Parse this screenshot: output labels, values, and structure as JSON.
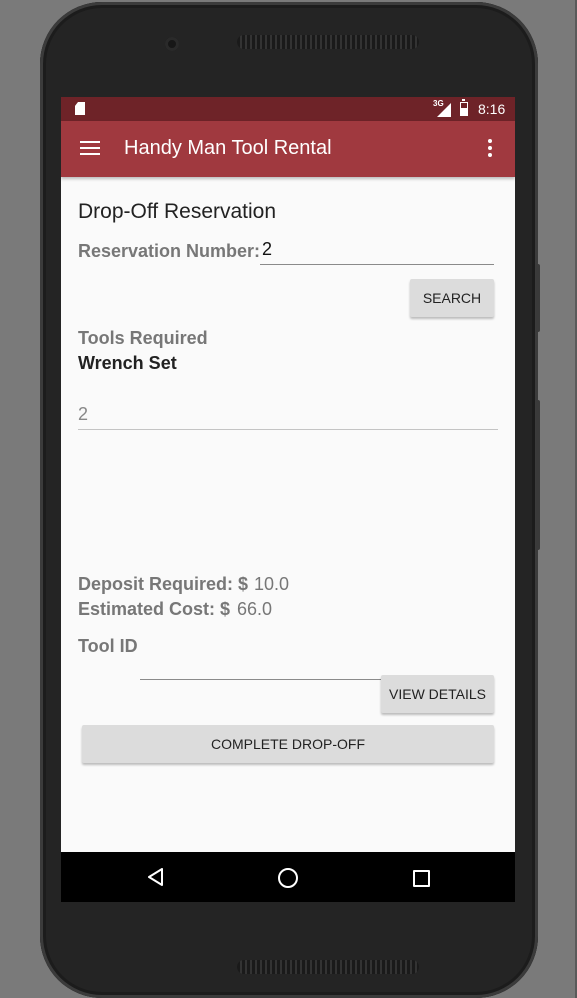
{
  "status_bar": {
    "network": "3G",
    "time": "8:16"
  },
  "app_bar": {
    "title": "Handy Man Tool Rental",
    "menu_icon": "hamburger-menu-icon",
    "overflow_icon": "more-vertical-icon"
  },
  "form": {
    "page_title": "Drop-Off Reservation",
    "reservation_number_label": "Reservation Number:",
    "reservation_number_value": "2",
    "search_button": "SEARCH",
    "tools_required_label": "Tools Required",
    "tool_name": "Wrench Set",
    "quantity_value": "2",
    "deposit_label": "Deposit Required: $",
    "deposit_value": "10.0",
    "estimated_cost_label": "Estimated Cost: $",
    "estimated_cost_value": "66.0",
    "tool_id_label": "Tool ID",
    "tool_id_value": "",
    "view_details_button": "VIEW DETAILS",
    "complete_dropoff_button": "COMPLETE DROP-OFF"
  },
  "nav_bar": {
    "back_icon": "back-triangle-icon",
    "home_icon": "home-circle-icon",
    "recents_icon": "recents-square-icon"
  },
  "colors": {
    "status_bar": "#6e2328",
    "app_bar": "#a0393f",
    "screen_background": "#fafafa",
    "button_background": "#dcdcdc"
  }
}
